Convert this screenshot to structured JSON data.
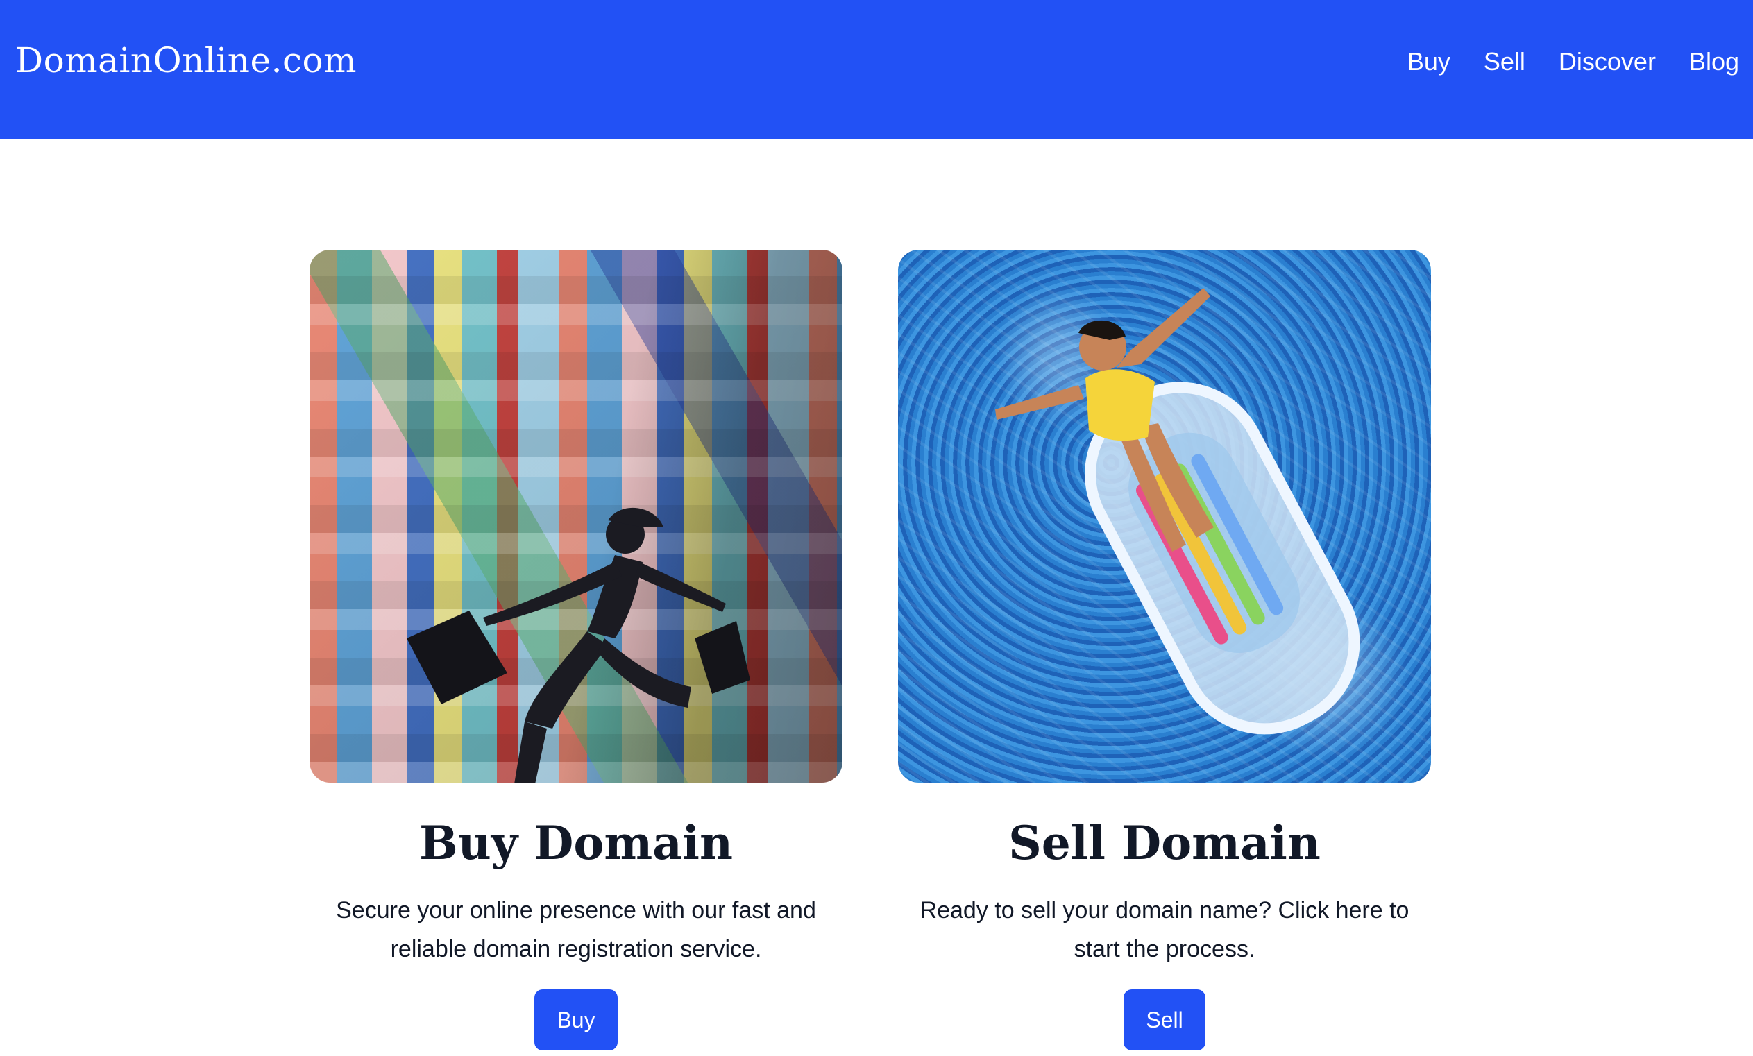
{
  "header": {
    "brand": "DomainOnline.com",
    "nav": [
      "Buy",
      "Sell",
      "Discover",
      "Blog"
    ]
  },
  "cards": [
    {
      "title": "Buy Domain",
      "text": "Secure your online presence with our fast and reliable domain registration service.",
      "button": "Buy"
    },
    {
      "title": "Sell Domain",
      "text": "Ready to sell your domain name? Click here to start the process.",
      "button": "Sell"
    }
  ],
  "colors": {
    "accent": "#2251f5",
    "text": "#111827",
    "background": "#ffffff"
  }
}
